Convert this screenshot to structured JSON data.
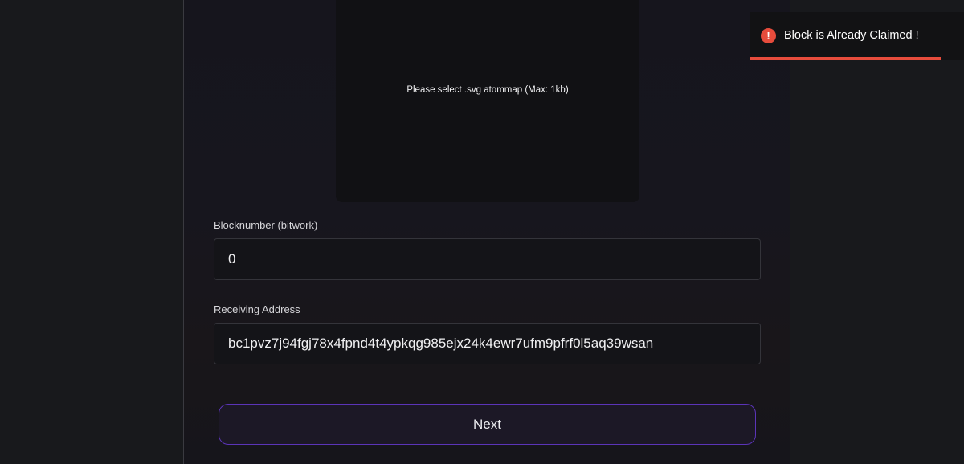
{
  "upload": {
    "prompt": "Please select .svg atommap (Max: 1kb)"
  },
  "form": {
    "bitwork_label": "Blocknumber (bitwork)",
    "bitwork_value": "0",
    "address_label": "Receiving Address",
    "address_value": "bc1pvz7j94fgj78x4fpnd4t4ypkqg985ejx24k4ewr7ufm9pfrf0l5aq39wsan",
    "next_label": "Next"
  },
  "toast": {
    "icon": "error-icon",
    "icon_glyph": "!",
    "message": "Block is Already Claimed !",
    "color": "#e74c3c",
    "progress_fraction": 0.89
  },
  "colors": {
    "accent_border": "#5b34b8",
    "error": "#e74c3c"
  }
}
